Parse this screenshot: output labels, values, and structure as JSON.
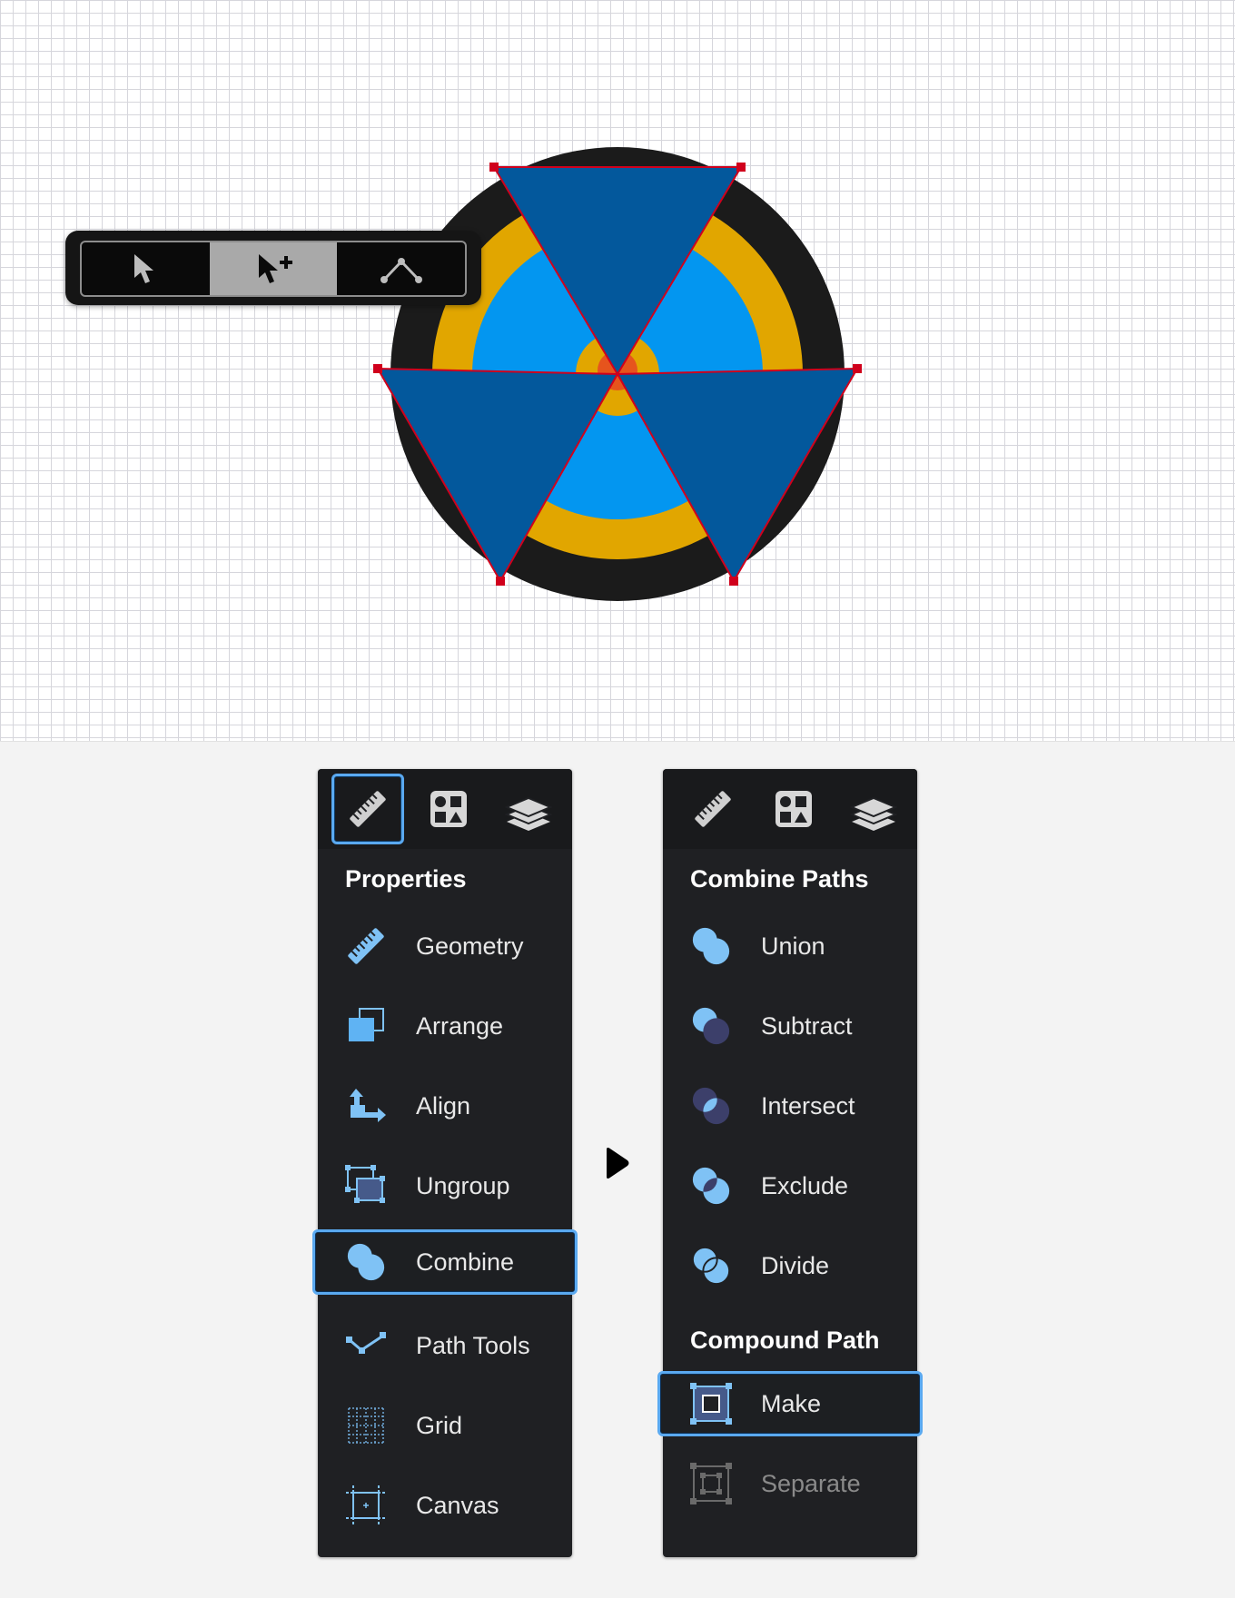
{
  "colors": {
    "accent": "#5aa9f0",
    "panel_bg": "#1f2023",
    "triangle_blue": "#03589c",
    "light_blue": "#0396f0",
    "gold": "#e1a600",
    "orange": "#e6541d",
    "dark_ring": "#1b1b1b",
    "selection_red": "#d0001c"
  },
  "toolbar": {
    "tools": [
      {
        "icon": "pointer-arrow-icon",
        "active": false
      },
      {
        "icon": "pointer-add-icon",
        "active": true
      },
      {
        "icon": "node-edit-icon",
        "active": false
      }
    ]
  },
  "left_panel": {
    "tabs": [
      {
        "icon": "ruler-icon",
        "selected": true
      },
      {
        "icon": "shapes-icon",
        "selected": false
      },
      {
        "icon": "layers-icon",
        "selected": false
      }
    ],
    "section_title": "Properties",
    "items": [
      {
        "label": "Geometry",
        "icon": "ruler-icon",
        "selected": false
      },
      {
        "label": "Arrange",
        "icon": "arrange-icon",
        "selected": false
      },
      {
        "label": "Align",
        "icon": "align-icon",
        "selected": false
      },
      {
        "label": "Ungroup",
        "icon": "ungroup-icon",
        "selected": false
      },
      {
        "label": "Combine",
        "icon": "combine-icon",
        "selected": true
      },
      {
        "label": "Path Tools",
        "icon": "path-tools-icon",
        "selected": false
      },
      {
        "label": "Grid",
        "icon": "grid-icon",
        "selected": false
      },
      {
        "label": "Canvas",
        "icon": "canvas-icon",
        "selected": false
      }
    ]
  },
  "right_panel": {
    "tabs": [
      {
        "icon": "ruler-icon",
        "selected": false
      },
      {
        "icon": "shapes-icon",
        "selected": false
      },
      {
        "icon": "layers-icon",
        "selected": false
      }
    ],
    "combine_title": "Combine Paths",
    "combine_items": [
      {
        "label": "Union",
        "icon": "union-icon"
      },
      {
        "label": "Subtract",
        "icon": "subtract-icon"
      },
      {
        "label": "Intersect",
        "icon": "intersect-icon"
      },
      {
        "label": "Exclude",
        "icon": "exclude-icon"
      },
      {
        "label": "Divide",
        "icon": "divide-icon"
      }
    ],
    "compound_title": "Compound Path",
    "compound_items": [
      {
        "label": "Make",
        "icon": "make-compound-icon",
        "selected": true,
        "disabled": false
      },
      {
        "label": "Separate",
        "icon": "separate-compound-icon",
        "selected": false,
        "disabled": true
      }
    ]
  }
}
